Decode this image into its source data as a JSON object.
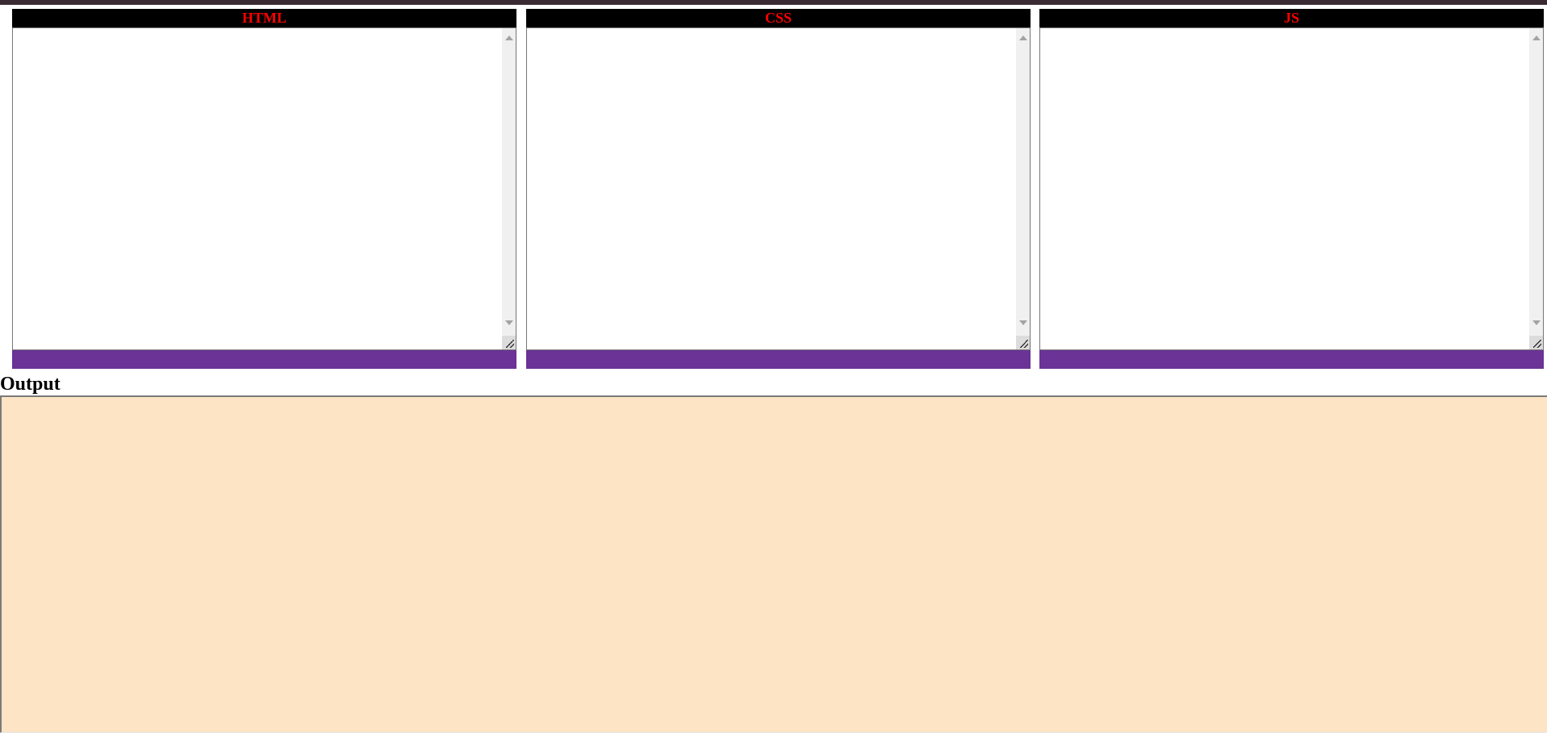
{
  "editors": [
    {
      "id": "html",
      "header": "HTML",
      "content": ""
    },
    {
      "id": "css",
      "header": "CSS",
      "content": ""
    },
    {
      "id": "js",
      "header": "JS",
      "content": ""
    }
  ],
  "output": {
    "title": "Output"
  },
  "colors": {
    "header_background": "#000000",
    "header_text": "#ff0000",
    "footer_bar": "#6a3395",
    "output_background": "#fde4c4",
    "top_bar": "#3a2a32"
  },
  "icons": {
    "scroll_up": "scroll-up-arrow-icon",
    "scroll_down": "scroll-down-arrow-icon",
    "resize": "resize-grip-icon"
  }
}
